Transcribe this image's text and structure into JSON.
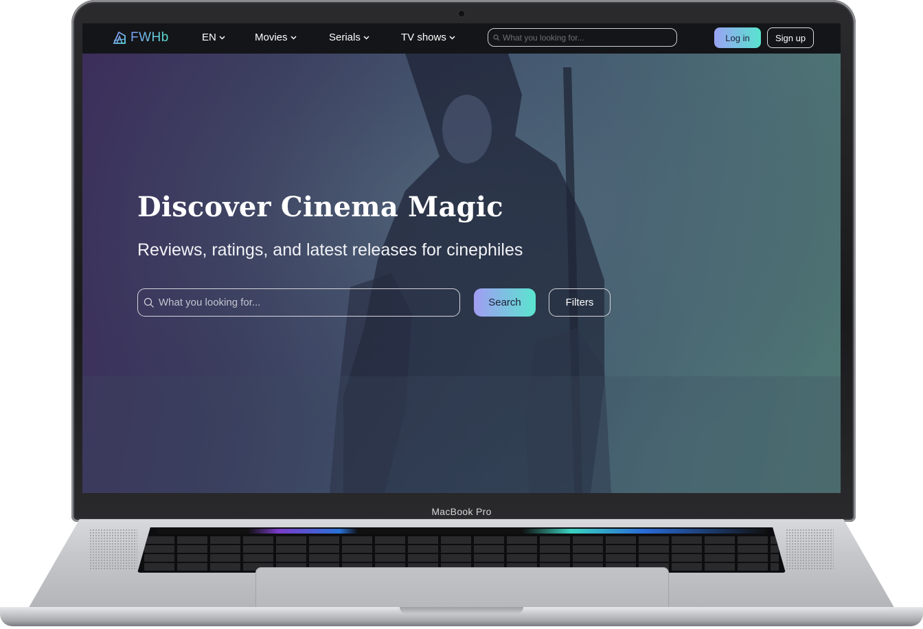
{
  "brand": {
    "name": "FWHb",
    "device_label": "MacBook Pro"
  },
  "nav": {
    "language": "EN",
    "items": [
      {
        "label": "Movies"
      },
      {
        "label": "Serials"
      },
      {
        "label": "TV shows"
      }
    ],
    "search_placeholder": "What you looking for...",
    "login_label": "Log in",
    "signup_label": "Sign up"
  },
  "hero": {
    "title": "Discover Cinema Magic",
    "subtitle": "Reviews, ratings, and latest releases for cinephiles",
    "search_placeholder": "What you looking for...",
    "search_button": "Search",
    "filters_button": "Filters"
  },
  "colors": {
    "accent_gradient_start": "#9aa2f4",
    "accent_gradient_end": "#58e4cf",
    "navbar_bg": "#141518"
  },
  "icons": [
    "logo-icon",
    "chevron-down-icon",
    "search-icon",
    "camera-icon"
  ]
}
